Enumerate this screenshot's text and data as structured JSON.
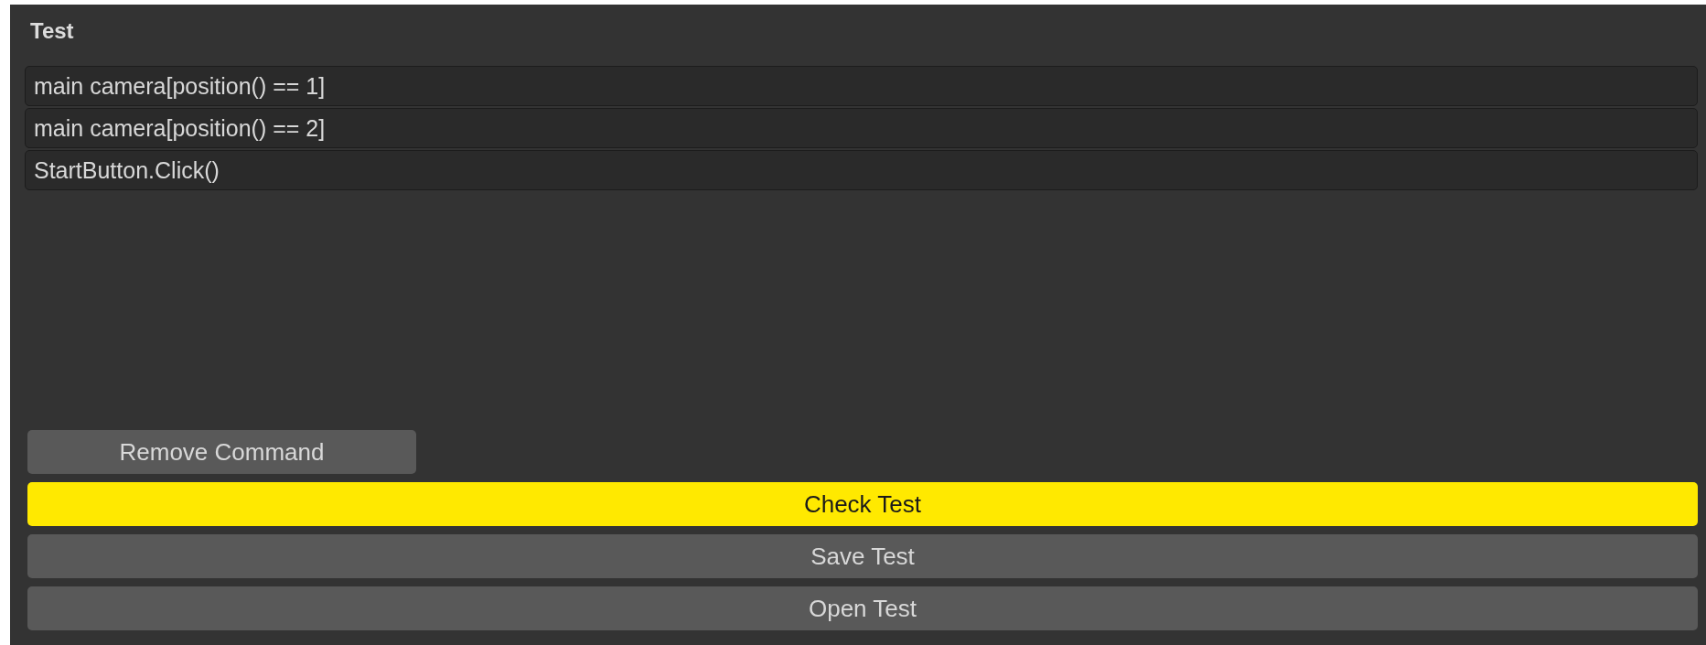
{
  "panel": {
    "title": "Test"
  },
  "commands": [
    {
      "text": "main camera[position() == 1]"
    },
    {
      "text": "main camera[position() == 2]"
    },
    {
      "text": "StartButton.Click()"
    }
  ],
  "remove_button": {
    "label": "Remove Command"
  },
  "buttons": [
    {
      "label": "Check Test",
      "highlighted": true
    },
    {
      "label": "Save Test",
      "highlighted": false
    },
    {
      "label": "Open Test",
      "highlighted": false
    }
  ]
}
